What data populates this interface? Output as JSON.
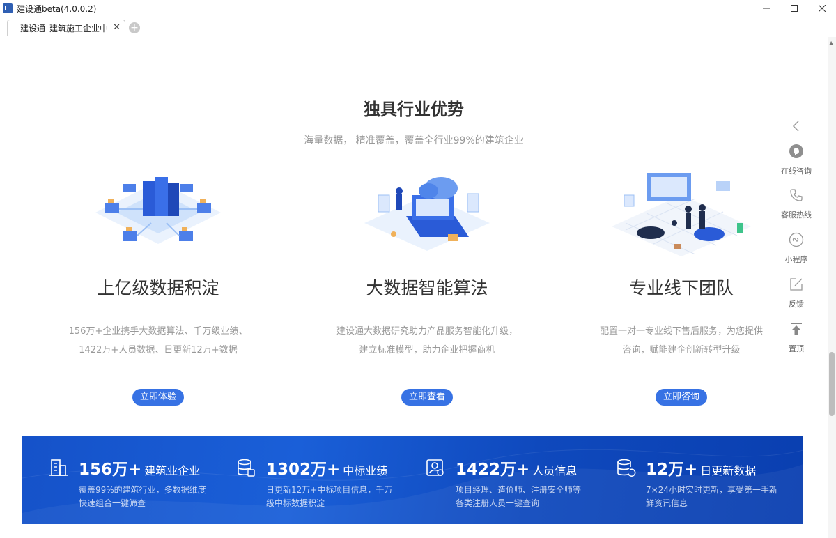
{
  "window": {
    "title": "建设通beta(4.0.0.2)",
    "minimize_icon": "minimize-icon",
    "maximize_icon": "maximize-icon",
    "close_icon": "close-icon"
  },
  "tabs": [
    {
      "label": "建设通_建筑施工企业中"
    }
  ],
  "section": {
    "title": "独具行业优势",
    "subtitle": "海量数据， 精准覆盖，覆盖全行业99%的建筑企业"
  },
  "features": [
    {
      "title": "上亿级数据积淀",
      "desc_line1": "156万+企业携手大数据算法、千万级业绩、",
      "desc_line2": "1422万+人员数据、日更新12万+数据",
      "button": "立即体验",
      "illustration": "data-center-illustration"
    },
    {
      "title": "大数据智能算法",
      "desc_line1": "建设通大数据研究助力产品服务智能化升级，",
      "desc_line2": "建立标准模型，助力企业把握商机",
      "button": "立即查看",
      "illustration": "cloud-algorithm-illustration"
    },
    {
      "title": "专业线下团队",
      "desc_line1": "配置一对一专业线下售后服务，为您提供",
      "desc_line2": "咨询，赋能建企创新转型升级",
      "button": "立即咨询",
      "illustration": "offline-team-illustration"
    }
  ],
  "stats": [
    {
      "number": "156万+",
      "label": "建筑业企业",
      "desc": "覆盖99%的建筑行业，多数据维度快速组合一键筛查",
      "icon": "building-icon"
    },
    {
      "number": "1302万+",
      "label": "中标业绩",
      "desc": "日更新12万+中标项目信息，千万级中标数据积淀",
      "icon": "database-icon"
    },
    {
      "number": "1422万+",
      "label": "人员信息",
      "desc": "项目经理、造价师、注册安全师等各类注册人员一键查询",
      "icon": "person-card-icon"
    },
    {
      "number": "12万+",
      "label": "日更新数据",
      "desc": "7×24小时实时更新，享受第一手新鲜资讯信息",
      "icon": "database-refresh-icon"
    }
  ],
  "floatbar": {
    "collapse_icon": "chevron-left-icon",
    "items": [
      {
        "label": "在线咨询",
        "icon": "chat-bubble-icon"
      },
      {
        "label": "客服热线",
        "icon": "phone-icon"
      },
      {
        "label": "小程序",
        "icon": "mini-program-icon"
      },
      {
        "label": "反馈",
        "icon": "edit-icon"
      },
      {
        "label": "置顶",
        "icon": "back-to-top-icon"
      }
    ]
  },
  "colors": {
    "accent": "#3772e4",
    "banner": "#1552c9",
    "title": "#333333",
    "muted": "#999999"
  }
}
